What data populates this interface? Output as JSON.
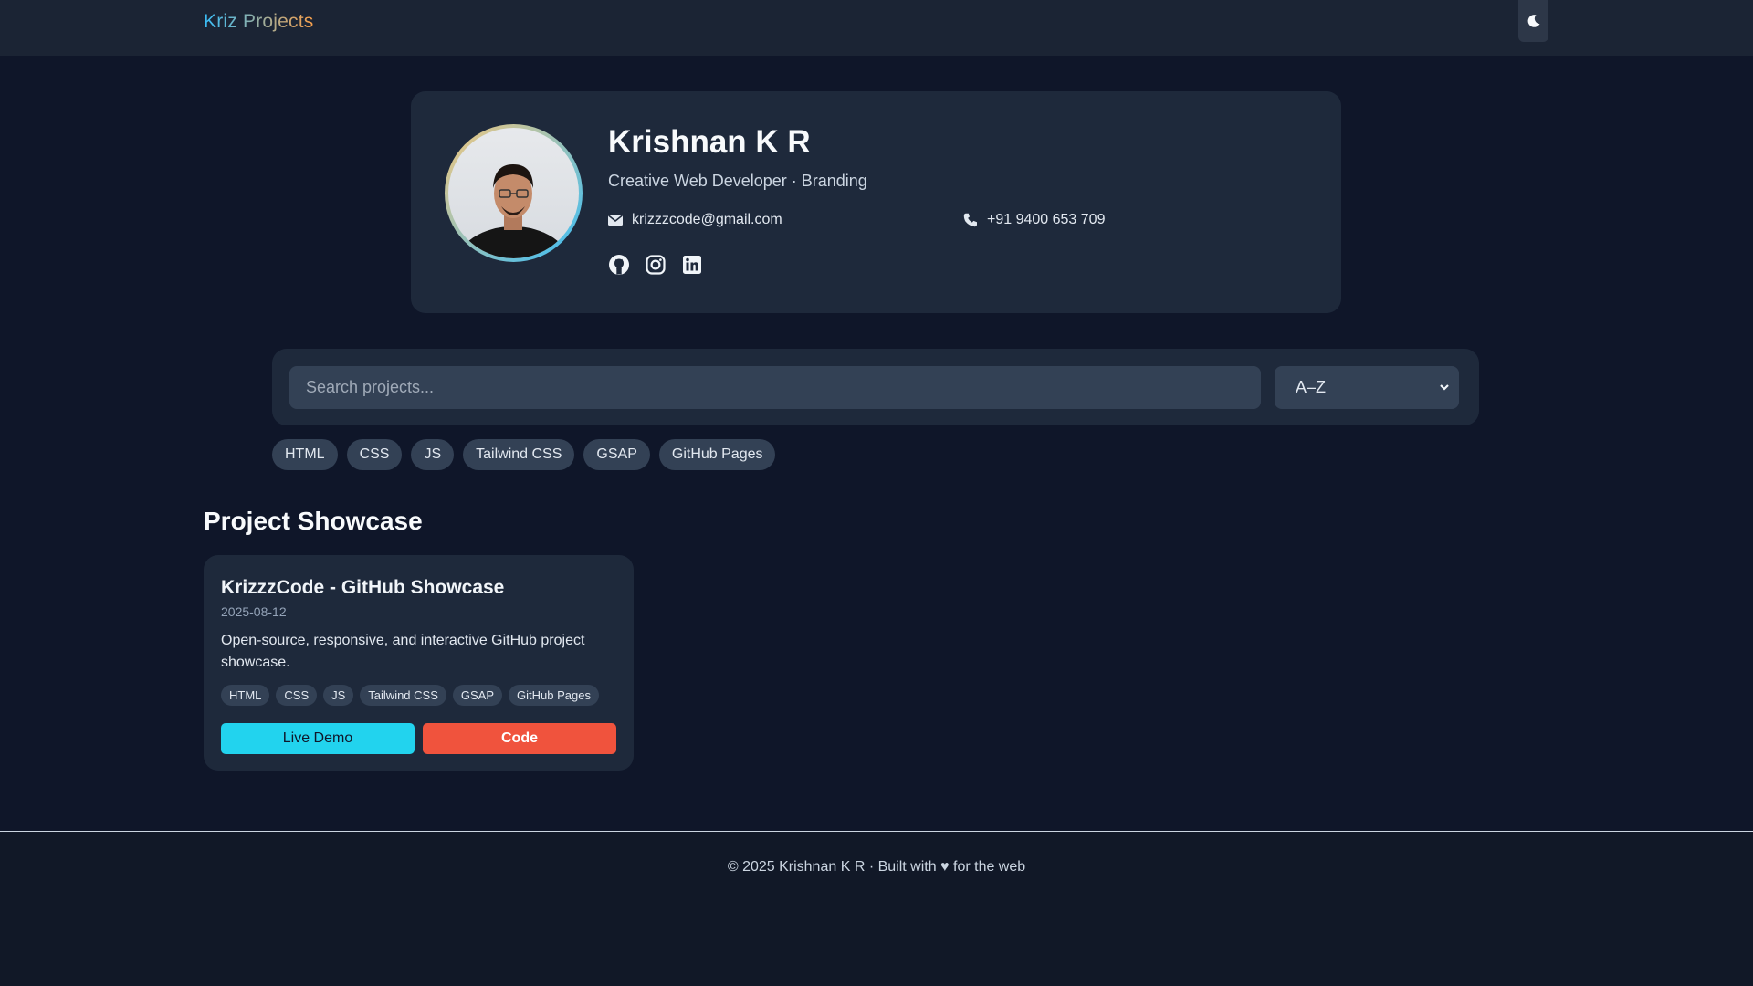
{
  "nav": {
    "brand": "Kriz Projects",
    "theme_toggle_icon": "moon-icon"
  },
  "profile": {
    "name": "Krishnan K R",
    "role": "Creative Web Developer · Branding",
    "email": "krizzzcode@gmail.com",
    "phone": "+91 9400 653 709",
    "socials": [
      "github-icon",
      "instagram-icon",
      "linkedin-icon"
    ]
  },
  "search": {
    "placeholder": "Search projects...",
    "sort_selected": "A–Z"
  },
  "filters": [
    "HTML",
    "CSS",
    "JS",
    "Tailwind CSS",
    "GSAP",
    "GitHub Pages"
  ],
  "showcase": {
    "title": "Project Showcase",
    "projects": [
      {
        "title": "KrizzzCode - GitHub Showcase",
        "date": "2025-08-12",
        "description": "Open-source, responsive, and interactive GitHub project showcase.",
        "tags": [
          "HTML",
          "CSS",
          "JS",
          "Tailwind CSS",
          "GSAP",
          "GitHub Pages"
        ],
        "demo_label": "Live Demo",
        "code_label": "Code"
      }
    ]
  },
  "footer": {
    "text": "© 2025 Krishnan K R · Built with ♥ for the web"
  },
  "colors": {
    "background": "#0f1629",
    "card": "#1e293b",
    "demo_button": "#22d3ee",
    "code_button": "#f0533d"
  }
}
